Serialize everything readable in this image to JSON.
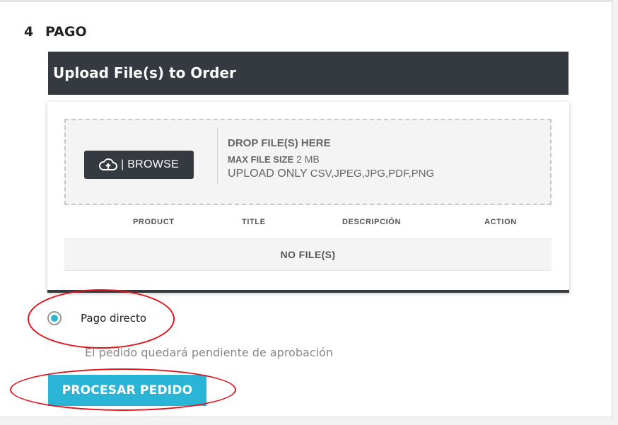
{
  "step": {
    "number": "4",
    "title": "PAGO"
  },
  "upload": {
    "header_title": "Upload File(s) to Order",
    "browse_label": "| BROWSE",
    "drop_label": "DROP FILE(S) HERE",
    "max_size_prefix": "MAX FILE SIZE",
    "max_size_value": "2 MB",
    "upload_only_prefix": "UPLOAD ONLY",
    "upload_only_types": "CSV,JPEG,JPG,PDF,PNG",
    "columns": [
      "PRODUCT",
      "TITLE",
      "DESCRIPCIÓN",
      "ACTION"
    ],
    "empty_text": "NO FILE(S)"
  },
  "payment": {
    "option_label": "Pago directo",
    "option_selected": true,
    "note": "El pedido quedará pendiente de aprobación"
  },
  "submit_label": "PROCESAR PEDIDO",
  "colors": {
    "header_bg": "#343a40",
    "accent": "#2ab4d6",
    "annotation": "#e1141e"
  },
  "icons": {
    "browse": "cloud-upload-icon"
  }
}
